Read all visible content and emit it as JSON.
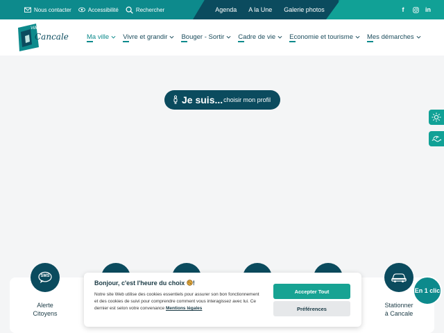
{
  "topbar": {
    "contact_label": "Nous contacter",
    "accessibility_label": "Accessibilité",
    "search_label": "Rechercher",
    "links": [
      "Agenda",
      "A la Une",
      "Galerie photos"
    ],
    "social": [
      "f",
      "ig",
      "in"
    ]
  },
  "logo": {
    "line1": "Ville de",
    "line2": "Cancale"
  },
  "nav": {
    "items": [
      {
        "label": "Ma ville"
      },
      {
        "label": "Vivre et grandir"
      },
      {
        "label": "Bouger - Sortir"
      },
      {
        "label": "Cadre de vie"
      },
      {
        "label": "Economie et tourisme"
      },
      {
        "label": "Mes démarches"
      }
    ]
  },
  "profile": {
    "big": "Je suis...",
    "small": "choisir mon profil"
  },
  "cards": {
    "first": [
      "Alerte",
      "Citoyens"
    ],
    "last": [
      "Stationner",
      "à Cancale"
    ],
    "first_icon_text": "SMS"
  },
  "en1clic": "En 1 clic",
  "cookie": {
    "title": "Bonjour, c'est l'heure du choix",
    "text": "Notre site Web utilise des cookies essentiels pour assurer son bon fonctionnement et des cookies de suivi pour comprendre comment vous interagissez avec lui. Ce dernier est selon votre convenance",
    "link": "Mentions légales",
    "accept": "Accepter Tout",
    "prefs": "Préférences"
  },
  "colors": {
    "teal": "#0d8a8c",
    "navy": "#0b4b5e",
    "green": "#17a393"
  }
}
